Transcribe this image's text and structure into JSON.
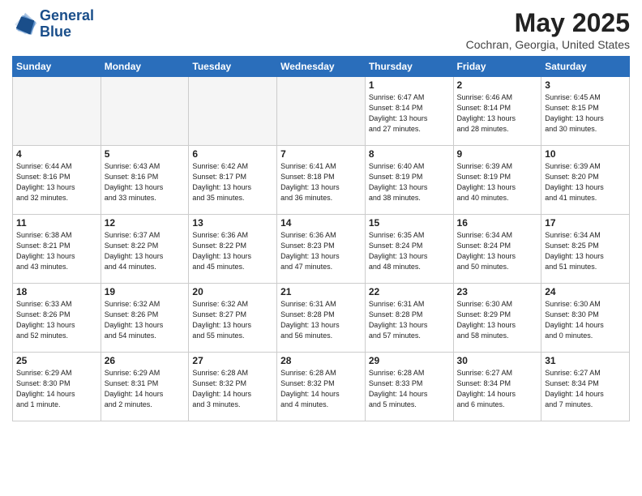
{
  "header": {
    "logo_line1": "General",
    "logo_line2": "Blue",
    "month_title": "May 2025",
    "location": "Cochran, Georgia, United States"
  },
  "weekdays": [
    "Sunday",
    "Monday",
    "Tuesday",
    "Wednesday",
    "Thursday",
    "Friday",
    "Saturday"
  ],
  "weeks": [
    [
      {
        "day": "",
        "info": ""
      },
      {
        "day": "",
        "info": ""
      },
      {
        "day": "",
        "info": ""
      },
      {
        "day": "",
        "info": ""
      },
      {
        "day": "1",
        "info": "Sunrise: 6:47 AM\nSunset: 8:14 PM\nDaylight: 13 hours\nand 27 minutes."
      },
      {
        "day": "2",
        "info": "Sunrise: 6:46 AM\nSunset: 8:14 PM\nDaylight: 13 hours\nand 28 minutes."
      },
      {
        "day": "3",
        "info": "Sunrise: 6:45 AM\nSunset: 8:15 PM\nDaylight: 13 hours\nand 30 minutes."
      }
    ],
    [
      {
        "day": "4",
        "info": "Sunrise: 6:44 AM\nSunset: 8:16 PM\nDaylight: 13 hours\nand 32 minutes."
      },
      {
        "day": "5",
        "info": "Sunrise: 6:43 AM\nSunset: 8:16 PM\nDaylight: 13 hours\nand 33 minutes."
      },
      {
        "day": "6",
        "info": "Sunrise: 6:42 AM\nSunset: 8:17 PM\nDaylight: 13 hours\nand 35 minutes."
      },
      {
        "day": "7",
        "info": "Sunrise: 6:41 AM\nSunset: 8:18 PM\nDaylight: 13 hours\nand 36 minutes."
      },
      {
        "day": "8",
        "info": "Sunrise: 6:40 AM\nSunset: 8:19 PM\nDaylight: 13 hours\nand 38 minutes."
      },
      {
        "day": "9",
        "info": "Sunrise: 6:39 AM\nSunset: 8:19 PM\nDaylight: 13 hours\nand 40 minutes."
      },
      {
        "day": "10",
        "info": "Sunrise: 6:39 AM\nSunset: 8:20 PM\nDaylight: 13 hours\nand 41 minutes."
      }
    ],
    [
      {
        "day": "11",
        "info": "Sunrise: 6:38 AM\nSunset: 8:21 PM\nDaylight: 13 hours\nand 43 minutes."
      },
      {
        "day": "12",
        "info": "Sunrise: 6:37 AM\nSunset: 8:22 PM\nDaylight: 13 hours\nand 44 minutes."
      },
      {
        "day": "13",
        "info": "Sunrise: 6:36 AM\nSunset: 8:22 PM\nDaylight: 13 hours\nand 45 minutes."
      },
      {
        "day": "14",
        "info": "Sunrise: 6:36 AM\nSunset: 8:23 PM\nDaylight: 13 hours\nand 47 minutes."
      },
      {
        "day": "15",
        "info": "Sunrise: 6:35 AM\nSunset: 8:24 PM\nDaylight: 13 hours\nand 48 minutes."
      },
      {
        "day": "16",
        "info": "Sunrise: 6:34 AM\nSunset: 8:24 PM\nDaylight: 13 hours\nand 50 minutes."
      },
      {
        "day": "17",
        "info": "Sunrise: 6:34 AM\nSunset: 8:25 PM\nDaylight: 13 hours\nand 51 minutes."
      }
    ],
    [
      {
        "day": "18",
        "info": "Sunrise: 6:33 AM\nSunset: 8:26 PM\nDaylight: 13 hours\nand 52 minutes."
      },
      {
        "day": "19",
        "info": "Sunrise: 6:32 AM\nSunset: 8:26 PM\nDaylight: 13 hours\nand 54 minutes."
      },
      {
        "day": "20",
        "info": "Sunrise: 6:32 AM\nSunset: 8:27 PM\nDaylight: 13 hours\nand 55 minutes."
      },
      {
        "day": "21",
        "info": "Sunrise: 6:31 AM\nSunset: 8:28 PM\nDaylight: 13 hours\nand 56 minutes."
      },
      {
        "day": "22",
        "info": "Sunrise: 6:31 AM\nSunset: 8:28 PM\nDaylight: 13 hours\nand 57 minutes."
      },
      {
        "day": "23",
        "info": "Sunrise: 6:30 AM\nSunset: 8:29 PM\nDaylight: 13 hours\nand 58 minutes."
      },
      {
        "day": "24",
        "info": "Sunrise: 6:30 AM\nSunset: 8:30 PM\nDaylight: 14 hours\nand 0 minutes."
      }
    ],
    [
      {
        "day": "25",
        "info": "Sunrise: 6:29 AM\nSunset: 8:30 PM\nDaylight: 14 hours\nand 1 minute."
      },
      {
        "day": "26",
        "info": "Sunrise: 6:29 AM\nSunset: 8:31 PM\nDaylight: 14 hours\nand 2 minutes."
      },
      {
        "day": "27",
        "info": "Sunrise: 6:28 AM\nSunset: 8:32 PM\nDaylight: 14 hours\nand 3 minutes."
      },
      {
        "day": "28",
        "info": "Sunrise: 6:28 AM\nSunset: 8:32 PM\nDaylight: 14 hours\nand 4 minutes."
      },
      {
        "day": "29",
        "info": "Sunrise: 6:28 AM\nSunset: 8:33 PM\nDaylight: 14 hours\nand 5 minutes."
      },
      {
        "day": "30",
        "info": "Sunrise: 6:27 AM\nSunset: 8:34 PM\nDaylight: 14 hours\nand 6 minutes."
      },
      {
        "day": "31",
        "info": "Sunrise: 6:27 AM\nSunset: 8:34 PM\nDaylight: 14 hours\nand 7 minutes."
      }
    ]
  ]
}
